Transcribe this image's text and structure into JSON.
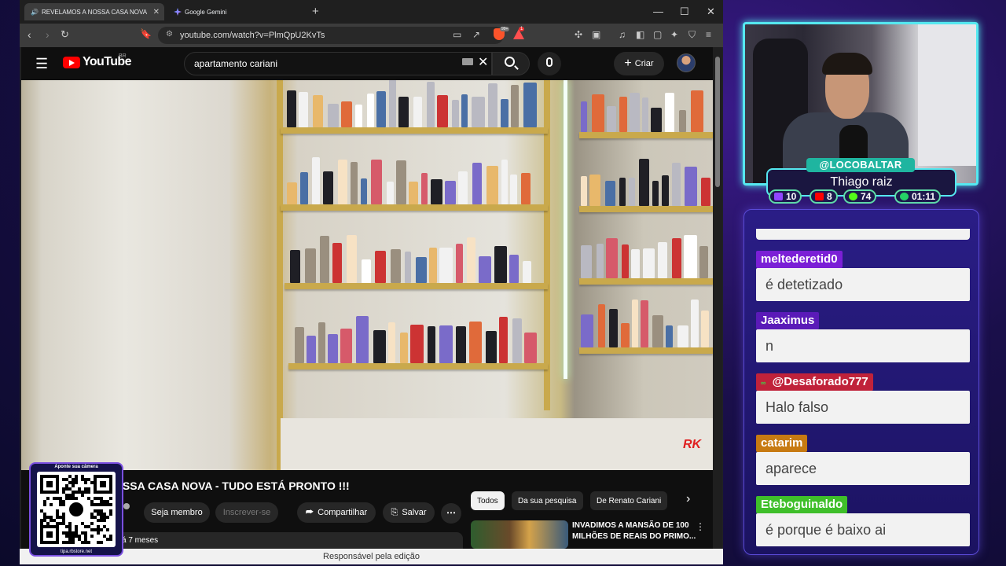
{
  "browser": {
    "tabs": [
      {
        "label": "REVELAMOS A NOSSA CASA NOVA",
        "active": true
      },
      {
        "label": "Google Gemini",
        "active": false
      }
    ],
    "url": "youtube.com/watch?v=PlmQpU2KvTs",
    "brave_shield_count": "99+",
    "rewards_count": "1"
  },
  "youtube": {
    "logo_text": "YouTube",
    "country": "BR",
    "search_query": "apartamento cariani",
    "create_label": "Criar",
    "video_title": "OSSA CASA NOVA - TUDO ESTÁ PRONTO !!!",
    "actions": {
      "join": "Seja membro",
      "subscribe": "Inscrever-se",
      "share": "Compartilhar",
      "save": "Salvar"
    },
    "description_snippet": "á 7 meses",
    "filter_chips": [
      "Todos",
      "Da sua pesquisa",
      "De Renato Cariani"
    ],
    "recommendation": {
      "title": "INVADIMOS A MANSÃO DE 100 MILHÕES DE REAIS DO PRIMO..."
    },
    "caption": "Responsável pela edição",
    "watermark": "RK"
  },
  "qr": {
    "top_text": "Aponte sua câmera",
    "bottom_text": "tipa.rbstore.net"
  },
  "stream": {
    "handle": "@LOCOBALTAR",
    "name": "Thiago raiz",
    "stats": [
      {
        "icon": "twitch-icon",
        "value": "10",
        "color": "#9146ff"
      },
      {
        "icon": "youtube-icon",
        "value": "8",
        "color": "#ff0000"
      },
      {
        "icon": "kick-icon",
        "value": "74",
        "color": "#53fc18"
      },
      {
        "icon": "timer-icon",
        "value": "01:11",
        "color": "#25d366"
      }
    ]
  },
  "chat": [
    {
      "user": "meltederetid0",
      "text": "é detetizado",
      "color": "#7b1fd6"
    },
    {
      "user": "Jaaximus",
      "text": "n",
      "color": "#5a1ab8"
    },
    {
      "user": "@Desaforado777",
      "text": "Halo falso",
      "color": "#c0223a"
    },
    {
      "user": "catarim",
      "text": "aparece",
      "color": "#c77a12"
    },
    {
      "user": "Eteboguinaldo",
      "text": "é porque é baixo ai",
      "color": "#3fbf2a"
    }
  ]
}
